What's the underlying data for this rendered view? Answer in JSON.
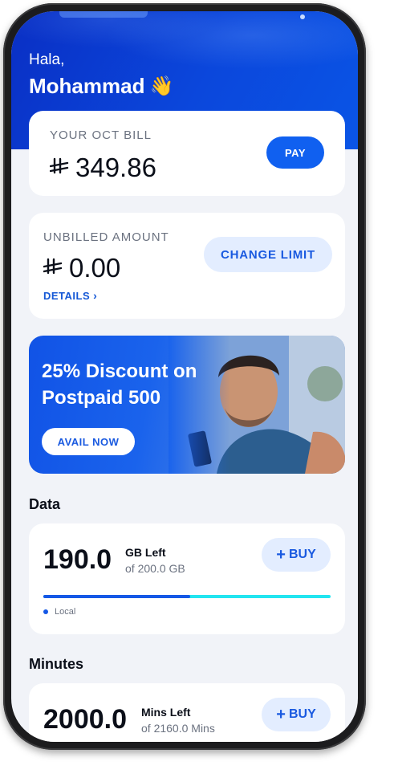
{
  "header": {
    "greeting": "Hala,",
    "name": "Mohammad",
    "emoji": "👋"
  },
  "bill": {
    "label": "YOUR OCT BILL",
    "currency_symbol": "⃁",
    "amount": "349.86",
    "pay_label": "PAY"
  },
  "unbilled": {
    "label": "UNBILLED AMOUNT",
    "currency_symbol": "⃁",
    "amount": "0.00",
    "change_limit_label": "CHANGE LIMIT",
    "details_label": "DETAILS",
    "details_chevron": "›"
  },
  "promo": {
    "title": "25% Discount on Postpaid 500",
    "cta_label": "AVAIL NOW"
  },
  "data": {
    "section_title": "Data",
    "remaining": "190.0",
    "unit_label": "GB Left",
    "total_label": "of 200.0 GB",
    "buy_label": "BUY",
    "buy_icon": "+",
    "progress_fraction": 0.51,
    "legend": "Local"
  },
  "minutes": {
    "section_title": "Minutes",
    "remaining": "2000.0",
    "unit_label": "Mins Left",
    "total_label": "of 2160.0 Mins",
    "buy_label": "BUY",
    "buy_icon": "+"
  },
  "colors": {
    "brand_blue": "#0b47dc",
    "accent": "#1060f0",
    "cyan": "#22e5f0"
  }
}
